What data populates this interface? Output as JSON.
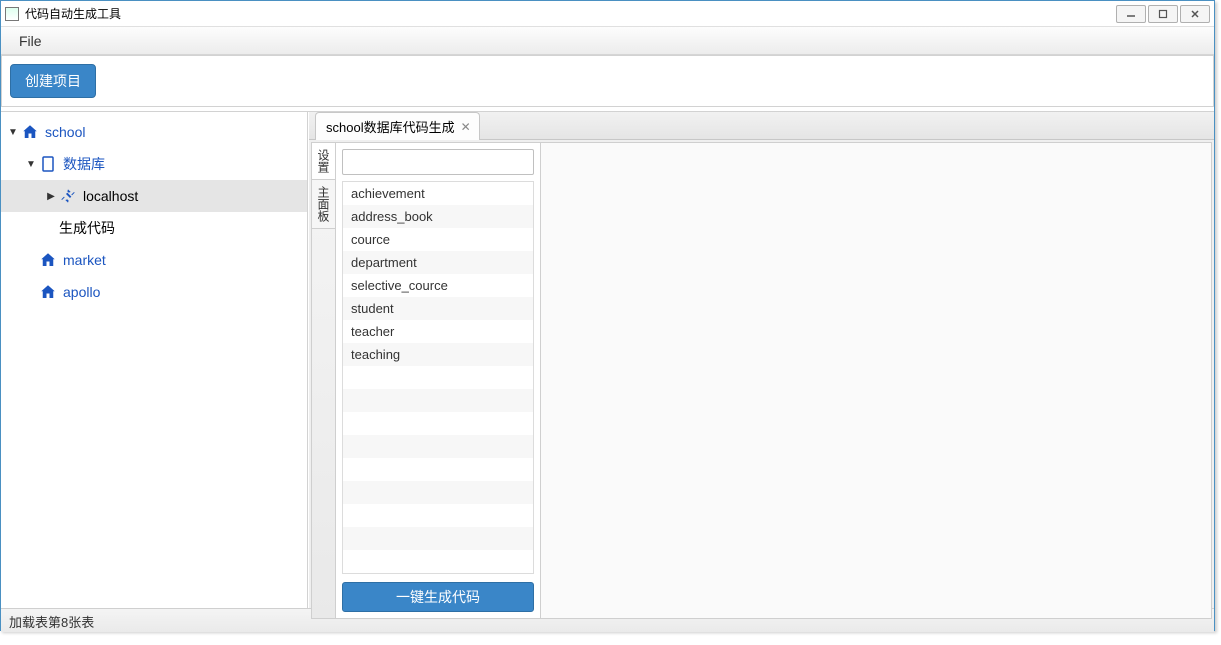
{
  "window": {
    "title": "代码自动生成工具"
  },
  "menubar": {
    "file": "File"
  },
  "toolbar": {
    "create_project": "创建项目"
  },
  "tree": {
    "school": {
      "label": "school"
    },
    "database": {
      "label": "数据库"
    },
    "localhost": {
      "label": "localhost"
    },
    "gen_code": {
      "label": "生成代码"
    },
    "market": {
      "label": "market"
    },
    "apollo": {
      "label": "apollo"
    }
  },
  "tab": {
    "label": "school数据库代码生成"
  },
  "vtabs": {
    "settings": "设置",
    "main_panel": "主面板"
  },
  "filter_placeholder": "",
  "tables": [
    "achievement",
    "address_book",
    "cource",
    "department",
    "selective_cource",
    "student",
    "teacher",
    "teaching"
  ],
  "generate_button": "一键生成代码",
  "status": "加载表第8张表"
}
